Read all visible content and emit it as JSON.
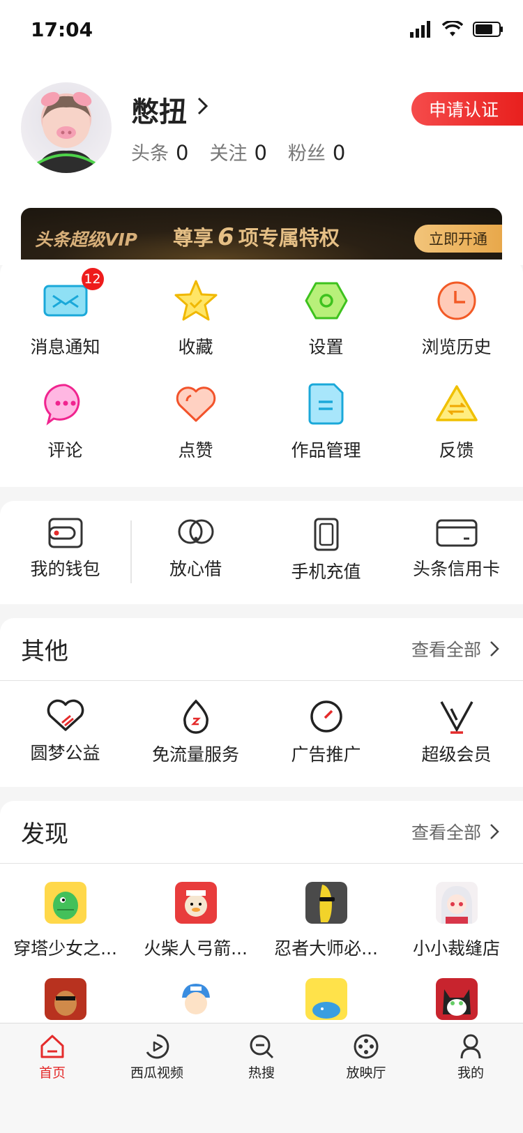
{
  "status_bar": {
    "time": "17:04"
  },
  "profile": {
    "username": "憋扭",
    "verify_button": "申请认证",
    "stats": [
      {
        "label": "头条",
        "value": "0"
      },
      {
        "label": "关注",
        "value": "0"
      },
      {
        "label": "粉丝",
        "value": "0"
      }
    ]
  },
  "vip": {
    "title": "头条超级VIP",
    "sub_prefix": "尊享",
    "sub_number": "6",
    "sub_suffix": "项专属特权",
    "button": "立即开通"
  },
  "functions": [
    {
      "label": "消息通知",
      "icon": "mail-icon",
      "badge": "12"
    },
    {
      "label": "收藏",
      "icon": "star-icon"
    },
    {
      "label": "设置",
      "icon": "gear-icon"
    },
    {
      "label": "浏览历史",
      "icon": "clock-icon"
    },
    {
      "label": "评论",
      "icon": "comment-icon"
    },
    {
      "label": "点赞",
      "icon": "heart-icon"
    },
    {
      "label": "作品管理",
      "icon": "document-icon"
    },
    {
      "label": "反馈",
      "icon": "feedback-icon"
    }
  ],
  "wallet": [
    {
      "label": "我的钱包",
      "icon": "wallet-icon"
    },
    {
      "label": "放心借",
      "icon": "loan-icon"
    },
    {
      "label": "手机充值",
      "icon": "phone-icon"
    },
    {
      "label": "头条信用卡",
      "icon": "credit-card-icon"
    }
  ],
  "other": {
    "title": "其他",
    "more": "查看全部",
    "items": [
      {
        "label": "圆梦公益",
        "icon": "charity-icon"
      },
      {
        "label": "免流量服务",
        "icon": "water-drop-icon"
      },
      {
        "label": "广告推广",
        "icon": "compass-icon"
      },
      {
        "label": "超级会员",
        "icon": "vip-v-icon"
      }
    ]
  },
  "discover": {
    "title": "发现",
    "more": "查看全部",
    "apps": [
      {
        "label": "穿塔少女之...",
        "icon": "dinosaur-game-icon"
      },
      {
        "label": "火柴人弓箭...",
        "icon": "hoodie-game-icon"
      },
      {
        "label": "忍者大师必...",
        "icon": "banana-game-icon"
      },
      {
        "label": "小小裁缝店",
        "icon": "anime-girl-icon"
      },
      {
        "label": "",
        "icon": "dog-game-icon"
      },
      {
        "label": "",
        "icon": "cartoon-face-icon"
      },
      {
        "label": "",
        "icon": "whale-game-icon"
      },
      {
        "label": "",
        "icon": "cat-game-icon"
      }
    ]
  },
  "tabbar": {
    "tabs": [
      {
        "label": "首页",
        "icon": "home-icon",
        "active": true
      },
      {
        "label": "西瓜视频",
        "icon": "video-play-icon"
      },
      {
        "label": "热搜",
        "icon": "search-icon"
      },
      {
        "label": "放映厅",
        "icon": "film-reel-icon"
      },
      {
        "label": "我的",
        "icon": "person-icon"
      }
    ]
  },
  "colors": {
    "accent": "#e42b2b",
    "vip_gold": "#e5bf85",
    "vip_dark": "#17130d"
  }
}
